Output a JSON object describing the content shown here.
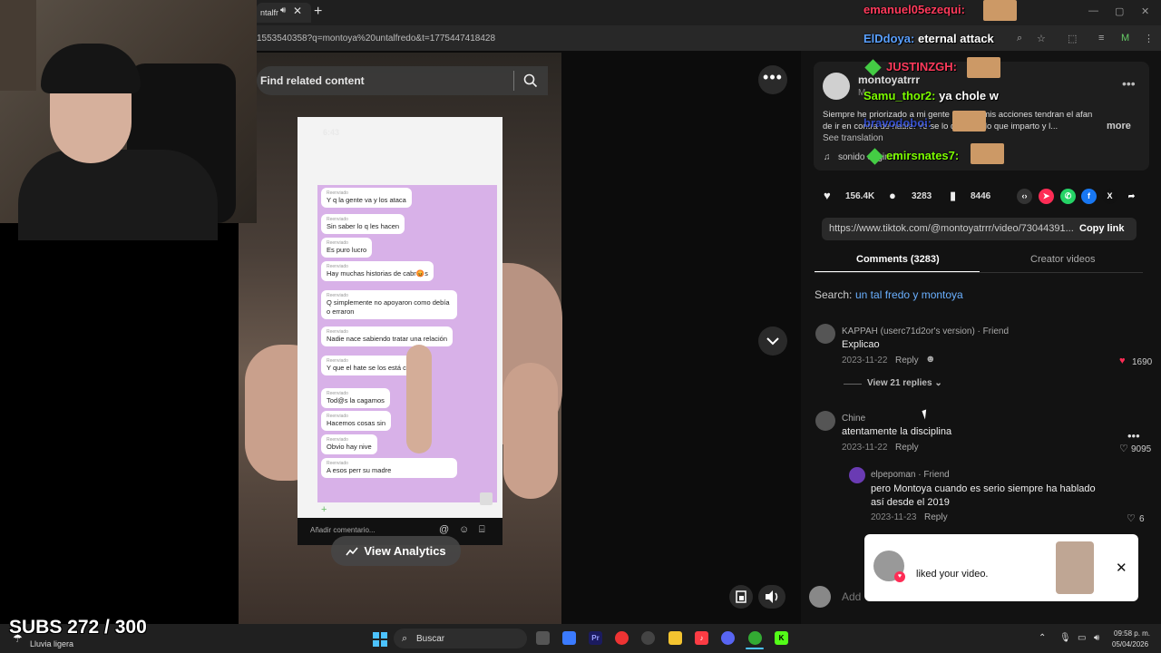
{
  "browser": {
    "tab_title": "ntalfr",
    "url": "1553540358?q=montoya%20untalfredo&t=1775447418428",
    "win_controls": [
      "—",
      "▢",
      "✕"
    ]
  },
  "video": {
    "search_placeholder": "Find related content",
    "view_analytics_label": "View Analytics",
    "more_label": "•••",
    "phone": {
      "time": "6:43",
      "forwarded_label": "Reenviado",
      "messages": [
        "Y q la gente va y los ataca",
        "Sin saber lo q les hacen",
        "Es puro lucro",
        "Hay muchas historias de cabr😡s",
        "Q simplemente no apoyaron como debía o erraron",
        "Nadie nace sabiendo tratar una relación",
        "Y que el hate se los está co      ndo",
        "Tod@s la cagamos",
        "Hacemos cosas sin",
        "Obvio hay nive",
        "A esos perr su madre"
      ],
      "comment_placeholder": "Añadir comentario..."
    }
  },
  "post": {
    "author": "montoyatrrr",
    "author_sub": "M",
    "caption": "Siempre he priorizado a mi gente , nunca mis acciones tendran el afan de ir en contra de nadie. Yo se lo que soy, lo que imparto y l...",
    "caption_more": "more",
    "see_translation": "See translation",
    "sound": "sonido original",
    "stats": {
      "likes": "156.4K",
      "comments": "3283",
      "saves": "8446"
    },
    "link": "https://www.tiktok.com/@montoyatrrr/video/73044391...",
    "copy_link": "Copy link"
  },
  "tabs": {
    "comments": "Comments (3283)",
    "creator": "Creator videos"
  },
  "search": {
    "label": "Search:",
    "term": "un tal fredo y montoya"
  },
  "comments": [
    {
      "name": "KAPPAH (userc71d2or's version) · Friend",
      "text": "Explicao",
      "date": "2023-11-22",
      "reply": "Reply",
      "likes": "1690"
    },
    {
      "name": "Chine",
      "text": "atentamente la disciplina",
      "date": "2023-11-22",
      "reply": "Reply",
      "likes": "9095"
    },
    {
      "name": "elpepoman · Friend",
      "text": "pero Montoya cuando es serio siempre ha hablado así desde el 2019",
      "date": "2023-11-23",
      "reply": "Reply",
      "likes": "6"
    }
  ],
  "view_replies": "View 21 replies",
  "add_comment": "Add",
  "notification": {
    "text": "liked your video."
  },
  "stream_chat": [
    {
      "user": "emanuel05ezequi:",
      "msg": "",
      "color": "#ff3b5c"
    },
    {
      "user": "ElDdoya:",
      "msg": "eternal attack",
      "color": "#5aa0ff"
    },
    {
      "user": "JUSTINZGH:",
      "msg": "",
      "color": "#ff3b5c"
    },
    {
      "user": "Samu_thor2:",
      "msg": "ya chole w",
      "color": "#7cfc00"
    },
    {
      "user": "bravodoboi:",
      "msg": "",
      "color": "#3b5cff"
    },
    {
      "user": "emirsnates7:",
      "msg": "",
      "color": "#7cfc00"
    }
  ],
  "overlay": {
    "subs": "SUBS 272 / 300"
  },
  "taskbar": {
    "weather": "Lluvia ligera",
    "search_placeholder": "Buscar",
    "time": "09:58 p. m.",
    "date": "05/04/2026"
  }
}
